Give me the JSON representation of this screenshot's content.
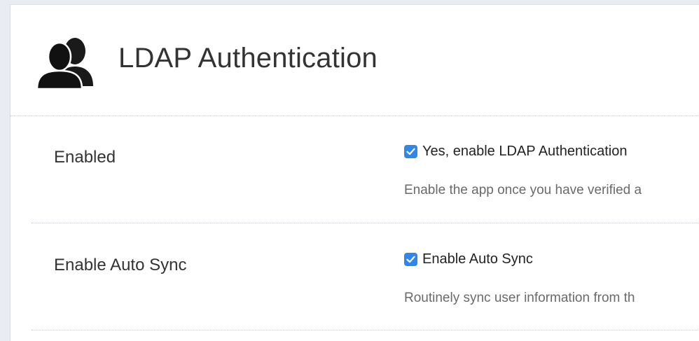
{
  "header": {
    "title": "LDAP Authentication",
    "icon": "users-group-icon"
  },
  "settings": [
    {
      "label": "Enabled",
      "checkbox_label": "Yes, enable LDAP Authentication",
      "checked": true,
      "description": "Enable the app once you have verified a"
    },
    {
      "label": "Enable Auto Sync",
      "checkbox_label": "Enable Auto Sync",
      "checked": true,
      "description": "Routinely sync user information from th"
    }
  ],
  "colors": {
    "checkbox": "#2f88e9",
    "text": "#333333",
    "muted": "#6a6a6a"
  }
}
